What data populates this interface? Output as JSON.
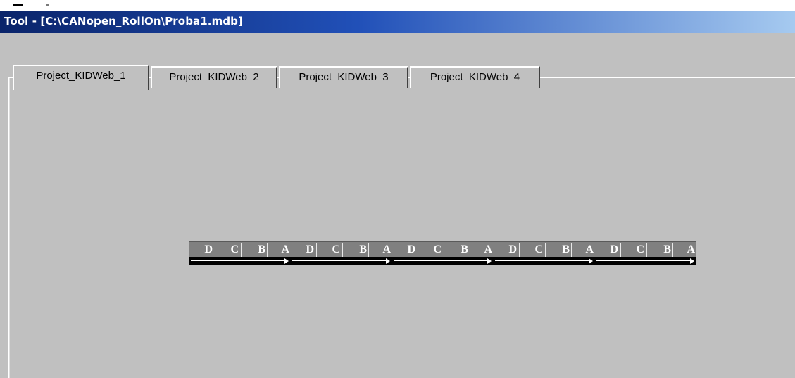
{
  "window": {
    "title": "Tool - [C:\\CANopen_RollOn\\Proba1.mdb]",
    "colors": {
      "titlebar_start": "#0a246a",
      "titlebar_end": "#a6caf0",
      "face": "#c0c0c0"
    }
  },
  "tabs": [
    {
      "label": "Project_KIDWeb_1",
      "active": true
    },
    {
      "label": "Project_KIDWeb_2",
      "active": false
    },
    {
      "label": "Project_KIDWeb_3",
      "active": false
    },
    {
      "label": "Project_KIDWeb_4",
      "active": false
    }
  ],
  "chain": {
    "segments": [
      {
        "cells": [
          "D",
          "C",
          "B",
          "A"
        ]
      },
      {
        "cells": [
          "D",
          "C",
          "B",
          "A"
        ]
      },
      {
        "cells": [
          "D",
          "C",
          "B",
          "A"
        ]
      },
      {
        "cells": [
          "D",
          "C",
          "B",
          "A"
        ]
      },
      {
        "cells": [
          "D",
          "C",
          "B",
          "A"
        ]
      }
    ],
    "icons": {
      "segment_arrow": "right-arrow-icon"
    }
  }
}
